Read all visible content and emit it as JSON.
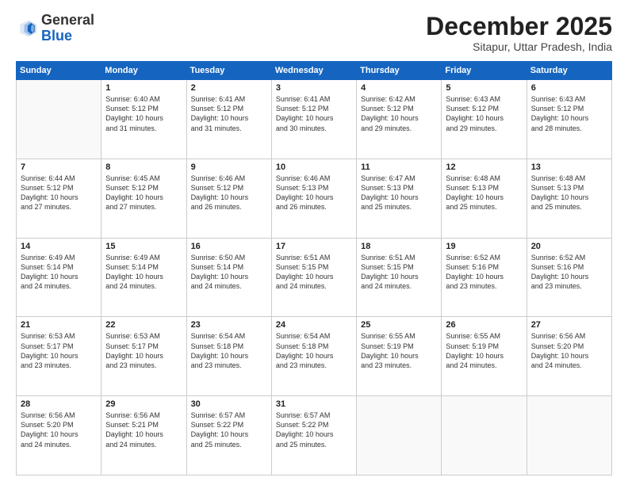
{
  "header": {
    "logo_general": "General",
    "logo_blue": "Blue",
    "month_title": "December 2025",
    "subtitle": "Sitapur, Uttar Pradesh, India"
  },
  "columns": [
    "Sunday",
    "Monday",
    "Tuesday",
    "Wednesday",
    "Thursday",
    "Friday",
    "Saturday"
  ],
  "weeks": [
    [
      {
        "day": "",
        "info": ""
      },
      {
        "day": "1",
        "info": "Sunrise: 6:40 AM\nSunset: 5:12 PM\nDaylight: 10 hours\nand 31 minutes."
      },
      {
        "day": "2",
        "info": "Sunrise: 6:41 AM\nSunset: 5:12 PM\nDaylight: 10 hours\nand 31 minutes."
      },
      {
        "day": "3",
        "info": "Sunrise: 6:41 AM\nSunset: 5:12 PM\nDaylight: 10 hours\nand 30 minutes."
      },
      {
        "day": "4",
        "info": "Sunrise: 6:42 AM\nSunset: 5:12 PM\nDaylight: 10 hours\nand 29 minutes."
      },
      {
        "day": "5",
        "info": "Sunrise: 6:43 AM\nSunset: 5:12 PM\nDaylight: 10 hours\nand 29 minutes."
      },
      {
        "day": "6",
        "info": "Sunrise: 6:43 AM\nSunset: 5:12 PM\nDaylight: 10 hours\nand 28 minutes."
      }
    ],
    [
      {
        "day": "7",
        "info": "Sunrise: 6:44 AM\nSunset: 5:12 PM\nDaylight: 10 hours\nand 27 minutes."
      },
      {
        "day": "8",
        "info": "Sunrise: 6:45 AM\nSunset: 5:12 PM\nDaylight: 10 hours\nand 27 minutes."
      },
      {
        "day": "9",
        "info": "Sunrise: 6:46 AM\nSunset: 5:12 PM\nDaylight: 10 hours\nand 26 minutes."
      },
      {
        "day": "10",
        "info": "Sunrise: 6:46 AM\nSunset: 5:13 PM\nDaylight: 10 hours\nand 26 minutes."
      },
      {
        "day": "11",
        "info": "Sunrise: 6:47 AM\nSunset: 5:13 PM\nDaylight: 10 hours\nand 25 minutes."
      },
      {
        "day": "12",
        "info": "Sunrise: 6:48 AM\nSunset: 5:13 PM\nDaylight: 10 hours\nand 25 minutes."
      },
      {
        "day": "13",
        "info": "Sunrise: 6:48 AM\nSunset: 5:13 PM\nDaylight: 10 hours\nand 25 minutes."
      }
    ],
    [
      {
        "day": "14",
        "info": "Sunrise: 6:49 AM\nSunset: 5:14 PM\nDaylight: 10 hours\nand 24 minutes."
      },
      {
        "day": "15",
        "info": "Sunrise: 6:49 AM\nSunset: 5:14 PM\nDaylight: 10 hours\nand 24 minutes."
      },
      {
        "day": "16",
        "info": "Sunrise: 6:50 AM\nSunset: 5:14 PM\nDaylight: 10 hours\nand 24 minutes."
      },
      {
        "day": "17",
        "info": "Sunrise: 6:51 AM\nSunset: 5:15 PM\nDaylight: 10 hours\nand 24 minutes."
      },
      {
        "day": "18",
        "info": "Sunrise: 6:51 AM\nSunset: 5:15 PM\nDaylight: 10 hours\nand 24 minutes."
      },
      {
        "day": "19",
        "info": "Sunrise: 6:52 AM\nSunset: 5:16 PM\nDaylight: 10 hours\nand 23 minutes."
      },
      {
        "day": "20",
        "info": "Sunrise: 6:52 AM\nSunset: 5:16 PM\nDaylight: 10 hours\nand 23 minutes."
      }
    ],
    [
      {
        "day": "21",
        "info": "Sunrise: 6:53 AM\nSunset: 5:17 PM\nDaylight: 10 hours\nand 23 minutes."
      },
      {
        "day": "22",
        "info": "Sunrise: 6:53 AM\nSunset: 5:17 PM\nDaylight: 10 hours\nand 23 minutes."
      },
      {
        "day": "23",
        "info": "Sunrise: 6:54 AM\nSunset: 5:18 PM\nDaylight: 10 hours\nand 23 minutes."
      },
      {
        "day": "24",
        "info": "Sunrise: 6:54 AM\nSunset: 5:18 PM\nDaylight: 10 hours\nand 23 minutes."
      },
      {
        "day": "25",
        "info": "Sunrise: 6:55 AM\nSunset: 5:19 PM\nDaylight: 10 hours\nand 23 minutes."
      },
      {
        "day": "26",
        "info": "Sunrise: 6:55 AM\nSunset: 5:19 PM\nDaylight: 10 hours\nand 24 minutes."
      },
      {
        "day": "27",
        "info": "Sunrise: 6:56 AM\nSunset: 5:20 PM\nDaylight: 10 hours\nand 24 minutes."
      }
    ],
    [
      {
        "day": "28",
        "info": "Sunrise: 6:56 AM\nSunset: 5:20 PM\nDaylight: 10 hours\nand 24 minutes."
      },
      {
        "day": "29",
        "info": "Sunrise: 6:56 AM\nSunset: 5:21 PM\nDaylight: 10 hours\nand 24 minutes."
      },
      {
        "day": "30",
        "info": "Sunrise: 6:57 AM\nSunset: 5:22 PM\nDaylight: 10 hours\nand 25 minutes."
      },
      {
        "day": "31",
        "info": "Sunrise: 6:57 AM\nSunset: 5:22 PM\nDaylight: 10 hours\nand 25 minutes."
      },
      {
        "day": "",
        "info": ""
      },
      {
        "day": "",
        "info": ""
      },
      {
        "day": "",
        "info": ""
      }
    ]
  ]
}
